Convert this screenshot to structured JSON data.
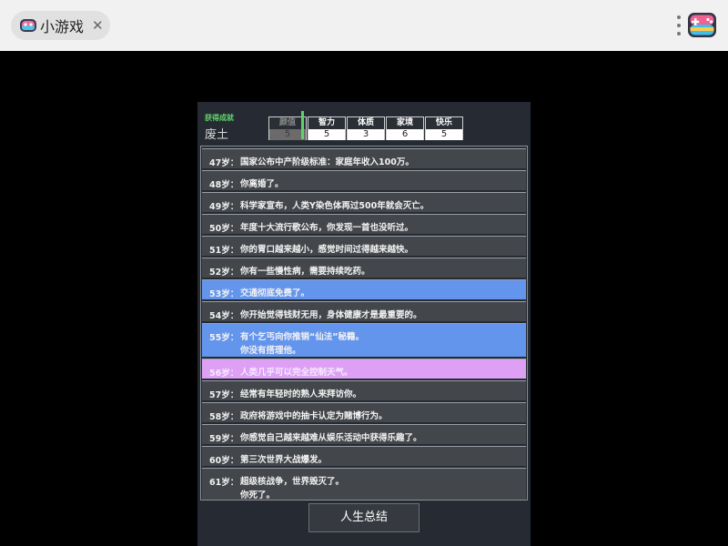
{
  "tab": {
    "title": "小游戏",
    "close": "✕",
    "icon": "gamepad-icon"
  },
  "menu": {
    "icon": "more-icon"
  },
  "logo": {
    "icon": "gamepad-logo-icon"
  },
  "status": {
    "achievement_label": "获得成就",
    "achievement_value": "废土",
    "attributes": [
      {
        "name": "颜值",
        "value": "5"
      },
      {
        "name": "智力",
        "value": "5"
      },
      {
        "name": "体质",
        "value": "3"
      },
      {
        "name": "家境",
        "value": "6"
      },
      {
        "name": "快乐",
        "value": "5"
      }
    ]
  },
  "log": [
    {
      "age": "47岁：",
      "lines": [
        "国家公布中产阶级标准：家庭年收入100万。"
      ],
      "style": "normal"
    },
    {
      "age": "48岁：",
      "lines": [
        "你离婚了。"
      ],
      "style": "normal"
    },
    {
      "age": "49岁：",
      "lines": [
        "科学家宣布，人类Y染色体再过500年就会灭亡。"
      ],
      "style": "normal"
    },
    {
      "age": "50岁：",
      "lines": [
        "年度十大流行歌公布，你发现一首也没听过。"
      ],
      "style": "normal"
    },
    {
      "age": "51岁：",
      "lines": [
        "你的胃口越来越小，感觉时间过得越来越快。"
      ],
      "style": "normal"
    },
    {
      "age": "52岁：",
      "lines": [
        "你有一些慢性病，需要持续吃药。"
      ],
      "style": "normal"
    },
    {
      "age": "53岁：",
      "lines": [
        "交通彻底免费了。"
      ],
      "style": "blue"
    },
    {
      "age": "54岁：",
      "lines": [
        "你开始觉得钱财无用，身体健康才是最重要的。"
      ],
      "style": "normal"
    },
    {
      "age": "55岁：",
      "lines": [
        "有个乞丐向你推销“仙法”秘籍。",
        "你没有搭理他。"
      ],
      "style": "blue"
    },
    {
      "age": "56岁：",
      "lines": [
        "人类几乎可以完全控制天气。"
      ],
      "style": "pink"
    },
    {
      "age": "57岁：",
      "lines": [
        "经常有年轻时的熟人来拜访你。"
      ],
      "style": "normal"
    },
    {
      "age": "58岁：",
      "lines": [
        "政府将游戏中的抽卡认定为赌博行为。"
      ],
      "style": "normal"
    },
    {
      "age": "59岁：",
      "lines": [
        "你感觉自己越来越难从娱乐活动中获得乐趣了。"
      ],
      "style": "normal"
    },
    {
      "age": "60岁：",
      "lines": [
        "第三次世界大战爆发。"
      ],
      "style": "normal"
    },
    {
      "age": "61岁：",
      "lines": [
        "超级核战争，世界毁灭了。",
        "你死了。"
      ],
      "style": "normal"
    }
  ],
  "summary_button": "人生总结",
  "colors": {
    "entry_normal": "#43464b",
    "entry_blue": "#6495ed",
    "entry_pink": "#dda0f5",
    "achievement_green": "#5fd36a"
  }
}
